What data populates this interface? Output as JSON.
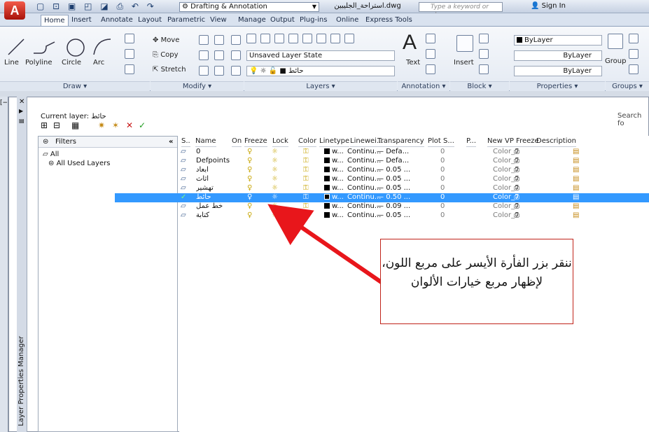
{
  "app": {
    "logo_glyph": "A"
  },
  "quick_access": {
    "icons": "▢ ⊡ ▣ ◰ ◪ ⎙ ↶ ↷"
  },
  "workspace": {
    "value": "Drafting & Annotation"
  },
  "document": {
    "title": "استراحة_الجليبين.dwg"
  },
  "search": {
    "placeholder": "Type a keyword or phrase"
  },
  "signin": {
    "label": "Sign In"
  },
  "tabs": [
    "Home",
    "Insert",
    "Annotate",
    "Layout",
    "Parametric",
    "View",
    "Manage",
    "Output",
    "Plug-ins",
    "Online",
    "Express Tools"
  ],
  "ribbon": {
    "draw": {
      "title": "Draw ▾",
      "tools": [
        "Line",
        "Polyline",
        "Circle",
        "Arc"
      ]
    },
    "modify": {
      "title": "Modify ▾",
      "tools": [
        "Move",
        "Copy",
        "Stretch"
      ]
    },
    "layers": {
      "title": "Layers ▾",
      "state": "Unsaved Layer State",
      "current": "حائط"
    },
    "annotation": {
      "title": "Annotation ▾",
      "text": "Text"
    },
    "block": {
      "title": "Block ▾",
      "insert": "Insert"
    },
    "properties": {
      "title": "Properties ▾",
      "color": "ByLayer",
      "linetype": "ByLayer",
      "lineweight": "ByLayer"
    },
    "groups": {
      "title": "Groups ▾",
      "group": "Group"
    }
  },
  "palette": {
    "collapse_glyph": "[−]",
    "side_label": "Layer Properties Manager",
    "current_layer_label": "Current layer:",
    "current_layer_value": "حائط",
    "search_label": "Search fo",
    "filters_header": "Filters",
    "filters_collapse": "«",
    "filter_tree": [
      "All",
      "All Used Layers"
    ]
  },
  "columns": [
    "S..",
    "Name",
    "On",
    "Freeze",
    "Lock",
    "Color",
    "Linetype",
    "Linewei...",
    "Transparency",
    "Plot S...",
    "P...",
    "New VP Freeze",
    "Description"
  ],
  "layers": [
    {
      "name": "0",
      "color": "w...",
      "linetype": "Continu...",
      "lineweight": "Defa...",
      "transparency": "0",
      "plot_style": "Color_7",
      "current": false
    },
    {
      "name": "Defpoints",
      "color": "w...",
      "linetype": "Continu...",
      "lineweight": "Defa...",
      "transparency": "0",
      "plot_style": "Color_7",
      "current": false
    },
    {
      "name": "ابعاد",
      "color": "w...",
      "linetype": "Continu...",
      "lineweight": "0.05 ...",
      "transparency": "0",
      "plot_style": "Color_7",
      "current": false
    },
    {
      "name": "اثاث",
      "color": "w...",
      "linetype": "Continu...",
      "lineweight": "0.05 ...",
      "transparency": "0",
      "plot_style": "Color_7",
      "current": false
    },
    {
      "name": "تهشير",
      "color": "w...",
      "linetype": "Continu...",
      "lineweight": "0.05 ...",
      "transparency": "0",
      "plot_style": "Color_7",
      "current": false
    },
    {
      "name": "حائط",
      "color": "w...",
      "linetype": "Continu...",
      "lineweight": "0.50 ...",
      "transparency": "0",
      "plot_style": "Color_7",
      "current": true
    },
    {
      "name": "خط عمل",
      "color": "w...",
      "linetype": "Continu...",
      "lineweight": "0.09 ...",
      "transparency": "0",
      "plot_style": "Color_7",
      "current": false
    },
    {
      "name": "كتابة",
      "color": "w...",
      "linetype": "Continu...",
      "lineweight": "0.05 ...",
      "transparency": "0",
      "plot_style": "Color_7",
      "current": false
    }
  ],
  "callout": {
    "text": "ننقر بزر الفأرة الأيسر على مربع اللون، لإظهار مربع خيارات الألوان"
  },
  "colors": {
    "selection": "#3399ff",
    "arrow": "#e8161b",
    "callout_border": "#c0231a"
  }
}
